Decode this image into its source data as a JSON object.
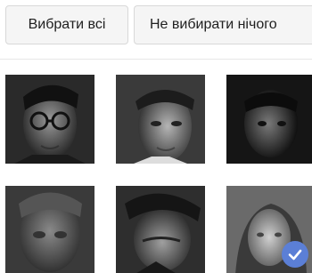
{
  "toolbar": {
    "select_all_label": "Вибрати всі",
    "select_none_label": "Не вибирати нічого"
  },
  "grid": {
    "photos": [
      {
        "name": "photo-1",
        "selected": false
      },
      {
        "name": "photo-2",
        "selected": false
      },
      {
        "name": "photo-3",
        "selected": false
      },
      {
        "name": "photo-4",
        "selected": false
      },
      {
        "name": "photo-5",
        "selected": false
      },
      {
        "name": "photo-6",
        "selected": true
      }
    ],
    "check_color": "#5b7fd6",
    "check_icon": "check-icon"
  }
}
